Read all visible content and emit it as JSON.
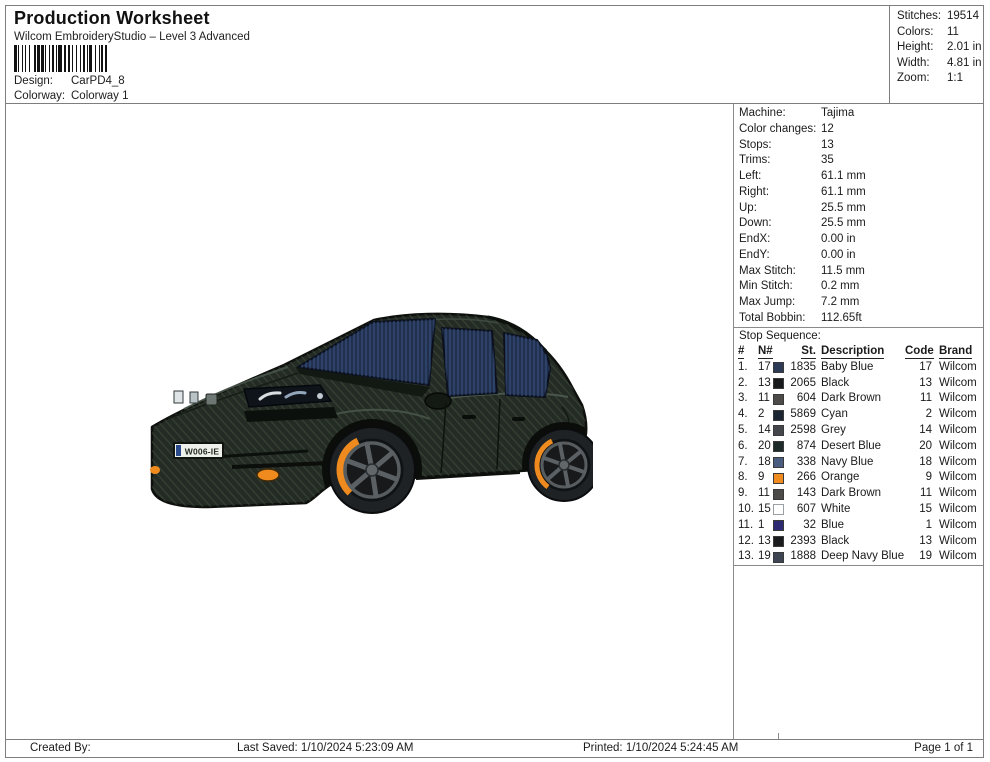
{
  "header": {
    "title": "Production Worksheet",
    "subtitle": "Wilcom EmbroideryStudio – Level 3 Advanced",
    "design_label": "Design:",
    "design_value": "CarPD4_8",
    "colorway_label": "Colorway:",
    "colorway_value": "Colorway 1",
    "barcode_pattern": "21121112131121211211211131212112121121112212111212"
  },
  "stats": [
    {
      "label": "Stitches:",
      "value": "19514"
    },
    {
      "label": "Colors:",
      "value": "11"
    },
    {
      "label": "Height:",
      "value": "2.01 in"
    },
    {
      "label": "Width:",
      "value": "4.81 in"
    },
    {
      "label": "Zoom:",
      "value": "1:1"
    }
  ],
  "machine_info": [
    {
      "label": "Machine:",
      "value": "Tajima"
    },
    {
      "label": "Color changes:",
      "value": "12"
    },
    {
      "label": "Stops:",
      "value": "13"
    },
    {
      "label": "Trims:",
      "value": "35"
    },
    {
      "label": "Left:",
      "value": "61.1 mm"
    },
    {
      "label": "Right:",
      "value": "61.1 mm"
    },
    {
      "label": "Up:",
      "value": "25.5 mm"
    },
    {
      "label": "Down:",
      "value": "25.5 mm"
    },
    {
      "label": "EndX:",
      "value": "0.00 in"
    },
    {
      "label": "EndY:",
      "value": "0.00 in"
    },
    {
      "label": "Max Stitch:",
      "value": "11.5 mm"
    },
    {
      "label": "Min Stitch:",
      "value": "0.2 mm"
    },
    {
      "label": "Max Jump:",
      "value": "7.2 mm"
    },
    {
      "label": "Total Bobbin:",
      "value": "112.65ft"
    }
  ],
  "stop_sequence": {
    "title": "Stop Sequence:",
    "columns": [
      "#",
      "N#",
      "St.",
      "Description",
      "Code",
      "Brand"
    ],
    "rows": [
      {
        "num": "1.",
        "n": "17",
        "swatch": "#2c3a55",
        "st": "1835",
        "description": "Baby Blue",
        "code": "17",
        "brand": "Wilcom"
      },
      {
        "num": "2.",
        "n": "13",
        "swatch": "#17191a",
        "st": "2065",
        "description": "Black",
        "code": "13",
        "brand": "Wilcom"
      },
      {
        "num": "3.",
        "n": "11",
        "swatch": "#4c4b47",
        "st": "604",
        "description": "Dark Brown",
        "code": "11",
        "brand": "Wilcom"
      },
      {
        "num": "4.",
        "n": "2",
        "swatch": "#1b2531",
        "st": "5869",
        "description": "Cyan",
        "code": "2",
        "brand": "Wilcom"
      },
      {
        "num": "5.",
        "n": "14",
        "swatch": "#43474b",
        "st": "2598",
        "description": "Grey",
        "code": "14",
        "brand": "Wilcom"
      },
      {
        "num": "6.",
        "n": "20",
        "swatch": "#1e2b2b",
        "st": "874",
        "description": "Desert Blue",
        "code": "20",
        "brand": "Wilcom"
      },
      {
        "num": "7.",
        "n": "18",
        "swatch": "#4a5c80",
        "st": "338",
        "description": "Navy Blue",
        "code": "18",
        "brand": "Wilcom"
      },
      {
        "num": "8.",
        "n": "9",
        "swatch": "#f08b1f",
        "st": "266",
        "description": "Orange",
        "code": "9",
        "brand": "Wilcom"
      },
      {
        "num": "9.",
        "n": "11",
        "swatch": "#4c4b47",
        "st": "143",
        "description": "Dark Brown",
        "code": "11",
        "brand": "Wilcom"
      },
      {
        "num": "10.",
        "n": "15",
        "swatch": "#ffffff",
        "st": "607",
        "description": "White",
        "code": "15",
        "brand": "Wilcom"
      },
      {
        "num": "11.",
        "n": "1",
        "swatch": "#2b2a72",
        "st": "32",
        "description": "Blue",
        "code": "1",
        "brand": "Wilcom"
      },
      {
        "num": "12.",
        "n": "13",
        "swatch": "#191b1c",
        "st": "2393",
        "description": "Black",
        "code": "13",
        "brand": "Wilcom"
      },
      {
        "num": "13.",
        "n": "19",
        "swatch": "#3d4553",
        "st": "1888",
        "description": "Deep Navy Blue",
        "code": "19",
        "brand": "Wilcom"
      }
    ]
  },
  "design": {
    "license_plate": "W006-IE",
    "body_color": "#232b24",
    "window_color": "#22304f",
    "accent_orange": "#ef8b1e",
    "wheel_gray": "#575c5f"
  },
  "footer": {
    "created_by": "Created By:",
    "last_saved": "Last Saved: 1/10/2024 5:23:09 AM",
    "printed": "Printed: 1/10/2024 5:24:45 AM",
    "page": "Page 1 of 1"
  }
}
